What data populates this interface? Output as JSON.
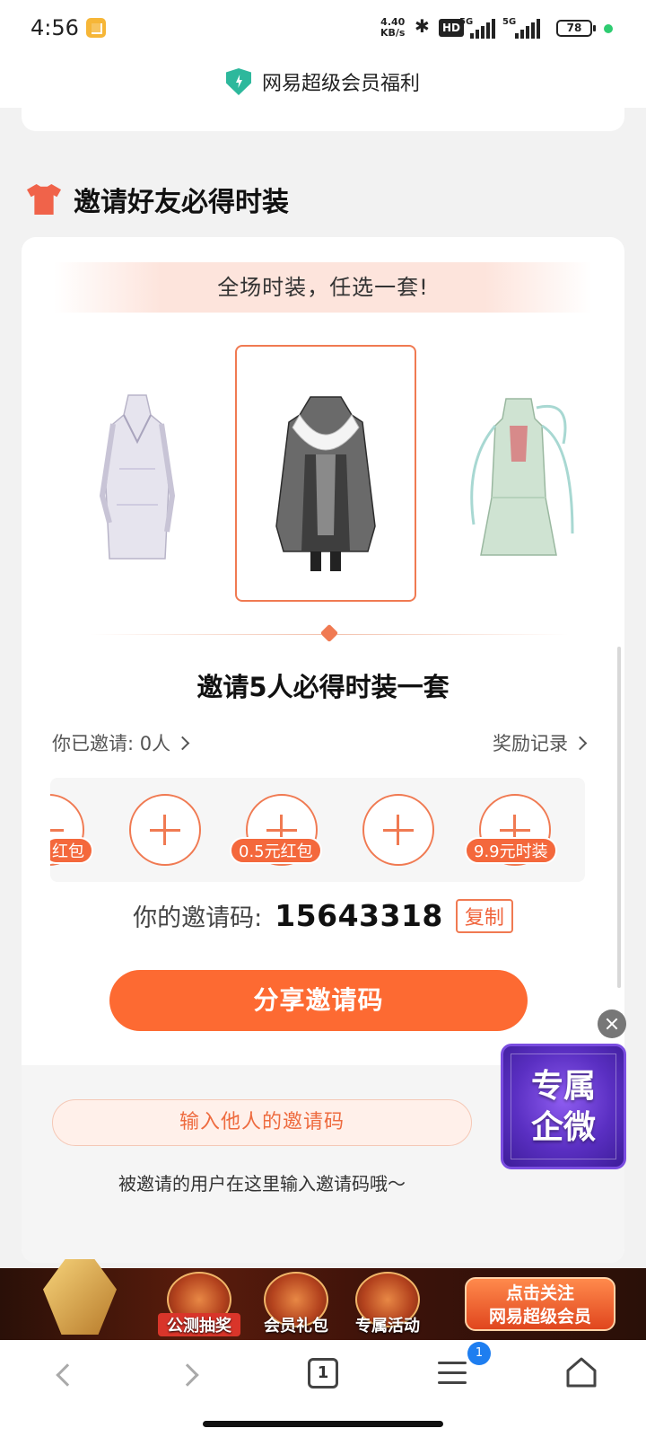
{
  "status_bar": {
    "time": "4:56",
    "net_speed_value": "4.40",
    "net_speed_unit": "KB/s",
    "hd_label": "HD",
    "sim1_label": "5G",
    "sim2_label": "5G",
    "battery": "78"
  },
  "header": {
    "title": "网易超级会员福利"
  },
  "section": {
    "title": "邀请好友必得时装"
  },
  "promo_banner": "全场时装，任选一套!",
  "outfits": [
    {
      "name": "white-robe"
    },
    {
      "name": "black-robe",
      "selected": true
    },
    {
      "name": "green-dress"
    }
  ],
  "invite": {
    "headline": "邀请5人必得时装一套",
    "invited_label": "你已邀请: 0人",
    "reward_record_label": "奖励记录",
    "slots": [
      {
        "tag": "红包"
      },
      {
        "tag": ""
      },
      {
        "tag": "0.5元红包"
      },
      {
        "tag": ""
      },
      {
        "tag": "9.9元时装"
      }
    ],
    "code_label": "你的邀请码:",
    "code_value": "15643318",
    "copy_label": "复制",
    "share_label": "分享邀请码"
  },
  "enter_code": {
    "button_label": "输入他人的邀请码",
    "hint": "被邀请的用户在这里输入邀请码哦～"
  },
  "float_widget": {
    "line1": "专属",
    "line2": "企微"
  },
  "promo_bar": {
    "items": [
      {
        "label": "公测抽奖"
      },
      {
        "label": "会员礼包"
      },
      {
        "label": "专属活动"
      }
    ],
    "follow_line1": "点击关注",
    "follow_line2": "网易超级会员"
  },
  "browser_nav": {
    "tab_count": "1",
    "badge_count": "1"
  },
  "colors": {
    "accent": "#fd6a32",
    "accent_border": "#f07a52",
    "shield": "#2db89c",
    "badge": "#1e7ef0"
  }
}
